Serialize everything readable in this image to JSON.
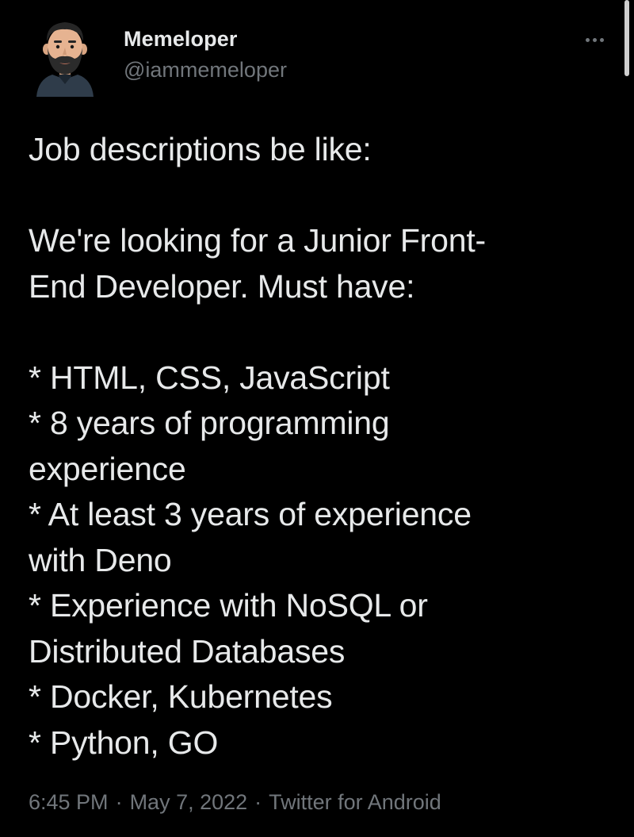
{
  "author": {
    "display_name": "Memeloper",
    "handle": "@iammemeloper",
    "avatar_icon": "bearded-man-avatar"
  },
  "more_icon": "more-horizontal-icon",
  "tweet": {
    "text": "Job descriptions be like:\n\nWe're looking for a Junior Front-\nEnd Developer. Must have:\n\n* HTML, CSS, JavaScript\n* 8 years of programming\nexperience\n* At least 3 years of experience\nwith Deno\n* Experience with NoSQL or\nDistributed Databases\n* Docker, Kubernetes\n* Python, GO"
  },
  "meta": {
    "time": "6:45 PM",
    "separator": "·",
    "date": "May 7, 2022",
    "source": "Twitter for Android"
  },
  "colors": {
    "background": "#000000",
    "primary_text": "#e7e9ea",
    "secondary_text": "#71767b"
  }
}
